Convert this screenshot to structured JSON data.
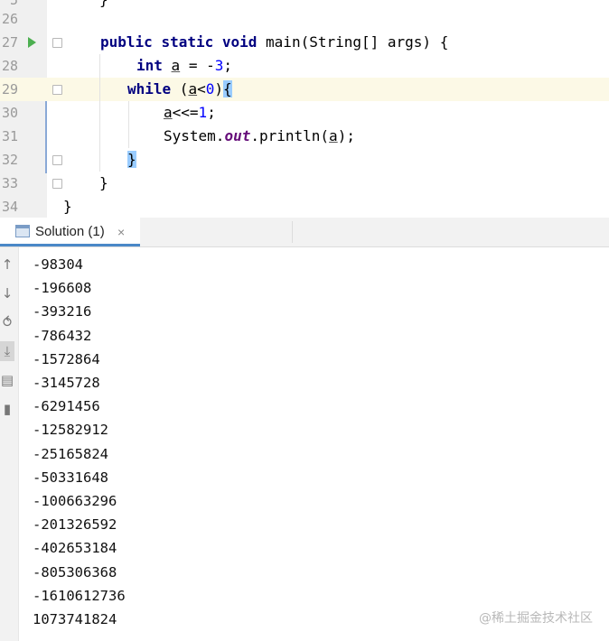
{
  "editor": {
    "line_numbers": [
      "5",
      "26",
      "27",
      "28",
      "29",
      "30",
      "31",
      "32",
      "33",
      "34"
    ],
    "code": {
      "l25": "}",
      "l27_kw1": "public",
      "l27_kw2": "static",
      "l27_kw3": "void",
      "l27_rest": " main(String[] args) {",
      "l28_kw": "int",
      "l28_var": "a",
      "l28_eq": " = -",
      "l28_num": "3",
      "l28_end": ";",
      "l29_kw": "while",
      "l29_open": " (",
      "l29_var": "a",
      "l29_lt": "<",
      "l29_num": "0",
      "l29_close": ")",
      "l29_brace": "{",
      "l30_var": "a",
      "l30_op": "<<=",
      "l30_num": "1",
      "l30_end": ";",
      "l31_sys": "System.",
      "l31_out": "out",
      "l31_call": ".println(",
      "l31_var": "a",
      "l31_end": ");",
      "l32_brace": "}",
      "l33": "}",
      "l34": "}"
    }
  },
  "run_panel": {
    "tab_label": "Solution (1)",
    "tab_close": "×",
    "output_lines": [
      "-98304",
      "-196608",
      "-393216",
      "-786432",
      "-1572864",
      "-3145728",
      "-6291456",
      "-12582912",
      "-25165824",
      "-50331648",
      "-100663296",
      "-201326592",
      "-402653184",
      "-805306368",
      "-1610612736",
      "1073741824"
    ]
  },
  "sidebar_icons": {
    "up": "↑",
    "down": "↓",
    "wrap": "⥀",
    "scroll": "⤓",
    "print": "▤",
    "trash": "▮"
  },
  "watermark": "@稀土掘金技术社区"
}
